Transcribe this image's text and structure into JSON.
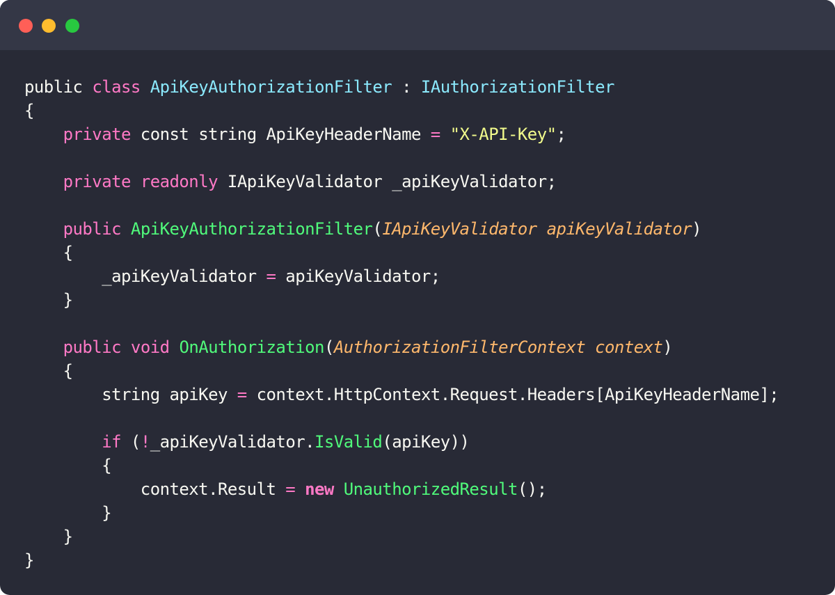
{
  "window": {
    "controls": [
      "close",
      "minimize",
      "maximize"
    ],
    "colors": {
      "background": "#282a36",
      "titlebar": "#343746",
      "close": "#ff5f57",
      "minimize": "#febc2e",
      "maximize": "#28c840"
    }
  },
  "code": {
    "language": "csharp",
    "lines": [
      [
        {
          "t": "public",
          "c": "plain"
        },
        {
          "t": " ",
          "c": "plain"
        },
        {
          "t": "class",
          "c": "kw"
        },
        {
          "t": " ",
          "c": "plain"
        },
        {
          "t": "ApiKeyAuthorizationFilter",
          "c": "type"
        },
        {
          "t": " : ",
          "c": "plain"
        },
        {
          "t": "IAuthorizationFilter",
          "c": "type"
        }
      ],
      [
        {
          "t": "{",
          "c": "plain"
        }
      ],
      [
        {
          "t": "    ",
          "c": "plain"
        },
        {
          "t": "private",
          "c": "kw"
        },
        {
          "t": " const string ApiKeyHeaderName ",
          "c": "plain"
        },
        {
          "t": "=",
          "c": "kw"
        },
        {
          "t": " ",
          "c": "plain"
        },
        {
          "t": "\"X-API-Key\"",
          "c": "str"
        },
        {
          "t": ";",
          "c": "plain"
        }
      ],
      [],
      [
        {
          "t": "    ",
          "c": "plain"
        },
        {
          "t": "private",
          "c": "kw"
        },
        {
          "t": " ",
          "c": "plain"
        },
        {
          "t": "readonly",
          "c": "kw"
        },
        {
          "t": " IApiKeyValidator _apiKeyValidator;",
          "c": "plain"
        }
      ],
      [],
      [
        {
          "t": "    ",
          "c": "plain"
        },
        {
          "t": "public",
          "c": "kw"
        },
        {
          "t": " ",
          "c": "plain"
        },
        {
          "t": "ApiKeyAuthorizationFilter",
          "c": "fn"
        },
        {
          "t": "(",
          "c": "plain"
        },
        {
          "t": "IApiKeyValidator apiKeyValidator",
          "c": "param"
        },
        {
          "t": ")",
          "c": "plain"
        }
      ],
      [
        {
          "t": "    {",
          "c": "plain"
        }
      ],
      [
        {
          "t": "        _apiKeyValidator ",
          "c": "plain"
        },
        {
          "t": "=",
          "c": "kw"
        },
        {
          "t": " apiKeyValidator;",
          "c": "plain"
        }
      ],
      [
        {
          "t": "    }",
          "c": "plain"
        }
      ],
      [],
      [
        {
          "t": "    ",
          "c": "plain"
        },
        {
          "t": "public",
          "c": "kw"
        },
        {
          "t": " ",
          "c": "plain"
        },
        {
          "t": "void",
          "c": "kw"
        },
        {
          "t": " ",
          "c": "plain"
        },
        {
          "t": "OnAuthorization",
          "c": "fn"
        },
        {
          "t": "(",
          "c": "plain"
        },
        {
          "t": "AuthorizationFilterContext context",
          "c": "param"
        },
        {
          "t": ")",
          "c": "plain"
        }
      ],
      [
        {
          "t": "    {",
          "c": "plain"
        }
      ],
      [
        {
          "t": "        string apiKey ",
          "c": "plain"
        },
        {
          "t": "=",
          "c": "kw"
        },
        {
          "t": " context.HttpContext.Request.Headers[ApiKeyHeaderName];",
          "c": "plain"
        }
      ],
      [],
      [
        {
          "t": "        ",
          "c": "plain"
        },
        {
          "t": "if",
          "c": "kw"
        },
        {
          "t": " (",
          "c": "plain"
        },
        {
          "t": "!",
          "c": "kw"
        },
        {
          "t": "_apiKeyValidator.",
          "c": "plain"
        },
        {
          "t": "IsValid",
          "c": "fn"
        },
        {
          "t": "(apiKey))",
          "c": "plain"
        }
      ],
      [
        {
          "t": "        {",
          "c": "plain"
        }
      ],
      [
        {
          "t": "            context.Result ",
          "c": "plain"
        },
        {
          "t": "=",
          "c": "kw"
        },
        {
          "t": " ",
          "c": "plain"
        },
        {
          "t": "new",
          "c": "kwb"
        },
        {
          "t": " ",
          "c": "plain"
        },
        {
          "t": "UnauthorizedResult",
          "c": "fn"
        },
        {
          "t": "();",
          "c": "plain"
        }
      ],
      [
        {
          "t": "        }",
          "c": "plain"
        }
      ],
      [
        {
          "t": "    }",
          "c": "plain"
        }
      ],
      [
        {
          "t": "}",
          "c": "plain"
        }
      ]
    ]
  }
}
